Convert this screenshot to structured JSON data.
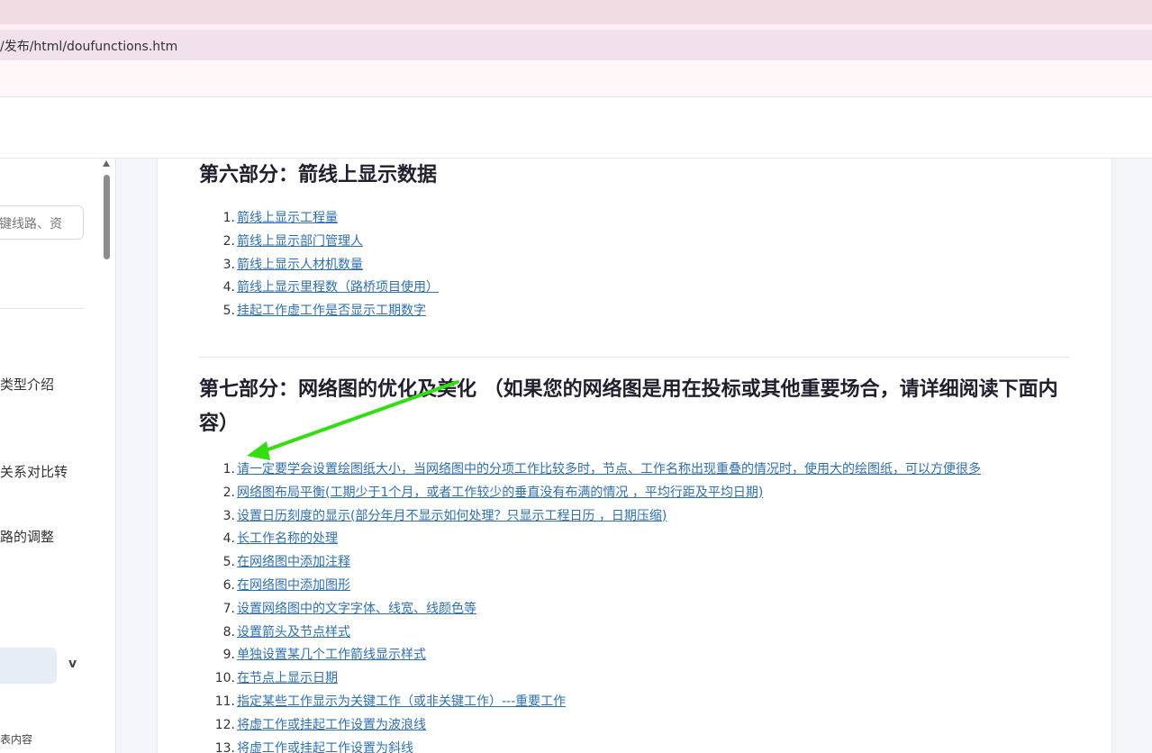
{
  "browser": {
    "url": "/发布/html/doufunctions.htm"
  },
  "sidebar": {
    "search_placeholder": "键线路、资",
    "items": [
      {
        "label": "类型介绍"
      },
      {
        "label": "关系对比转"
      },
      {
        "label": "路的调整"
      }
    ],
    "expand_label": "v",
    "small_item": "表内容"
  },
  "content": {
    "section6": {
      "title": "第六部分：箭线上显示数据",
      "items": [
        {
          "num": "1.",
          "text": "箭线上显示工程量"
        },
        {
          "num": "2.",
          "text": "箭线上显示部门管理人"
        },
        {
          "num": "3.",
          "text": "箭线上显示人材机数量"
        },
        {
          "num": "4.",
          "text": "箭线上显示里程数（路桥项目使用）"
        },
        {
          "num": "5.",
          "text": "挂起工作虚工作是否显示工期数字"
        }
      ]
    },
    "section7": {
      "title": "第七部分：网络图的优化及美化 （如果您的网络图是用在投标或其他重要场合，请详细阅读下面内容）",
      "items": [
        {
          "num": "1.",
          "text": "请一定要学会设置绘图纸大小，当网络图中的分项工作比较多时，节点、工作名称出现重叠的情况时，使用大的绘图纸，可以方便很多"
        },
        {
          "num": "2.",
          "text": "网络图布局平衡(工期少于1个月，或者工作较少的垂直没有布满的情况 ，平均行距及平均日期)"
        },
        {
          "num": "3.",
          "text": "设置日历刻度的显示(部分年月不显示如何处理？只显示工程日历 ，日期压缩)"
        },
        {
          "num": "4.",
          "text": "长工作名称的处理"
        },
        {
          "num": "5.",
          "text": "在网络图中添加注释"
        },
        {
          "num": "6.",
          "text": "在网络图中添加图形"
        },
        {
          "num": "7.",
          "text": "设置网络图中的文字字体、线宽、线颜色等"
        },
        {
          "num": "8.",
          "text": "设置箭头及节点样式"
        },
        {
          "num": "9.",
          "text": "单独设置某几个工作箭线显示样式"
        },
        {
          "num": "10.",
          "text": "在节点上显示日期"
        },
        {
          "num": "11.",
          "text": "指定某些工作显示为关键工作（或非关键工作）---重要工作"
        },
        {
          "num": "12.",
          "text": "将虚工作或挂起工作设置为波浪线"
        },
        {
          "num": "13.",
          "text": "将虚工作或挂起工作设置为斜线"
        }
      ]
    }
  },
  "annotation": {
    "arrow_color": "#33dd11",
    "icon": "green-arrow-annotation-icon"
  },
  "colors": {
    "link": "#2f6fb0",
    "tabstrip": "#f2dce3",
    "addressbar": "#f0e1ea"
  }
}
